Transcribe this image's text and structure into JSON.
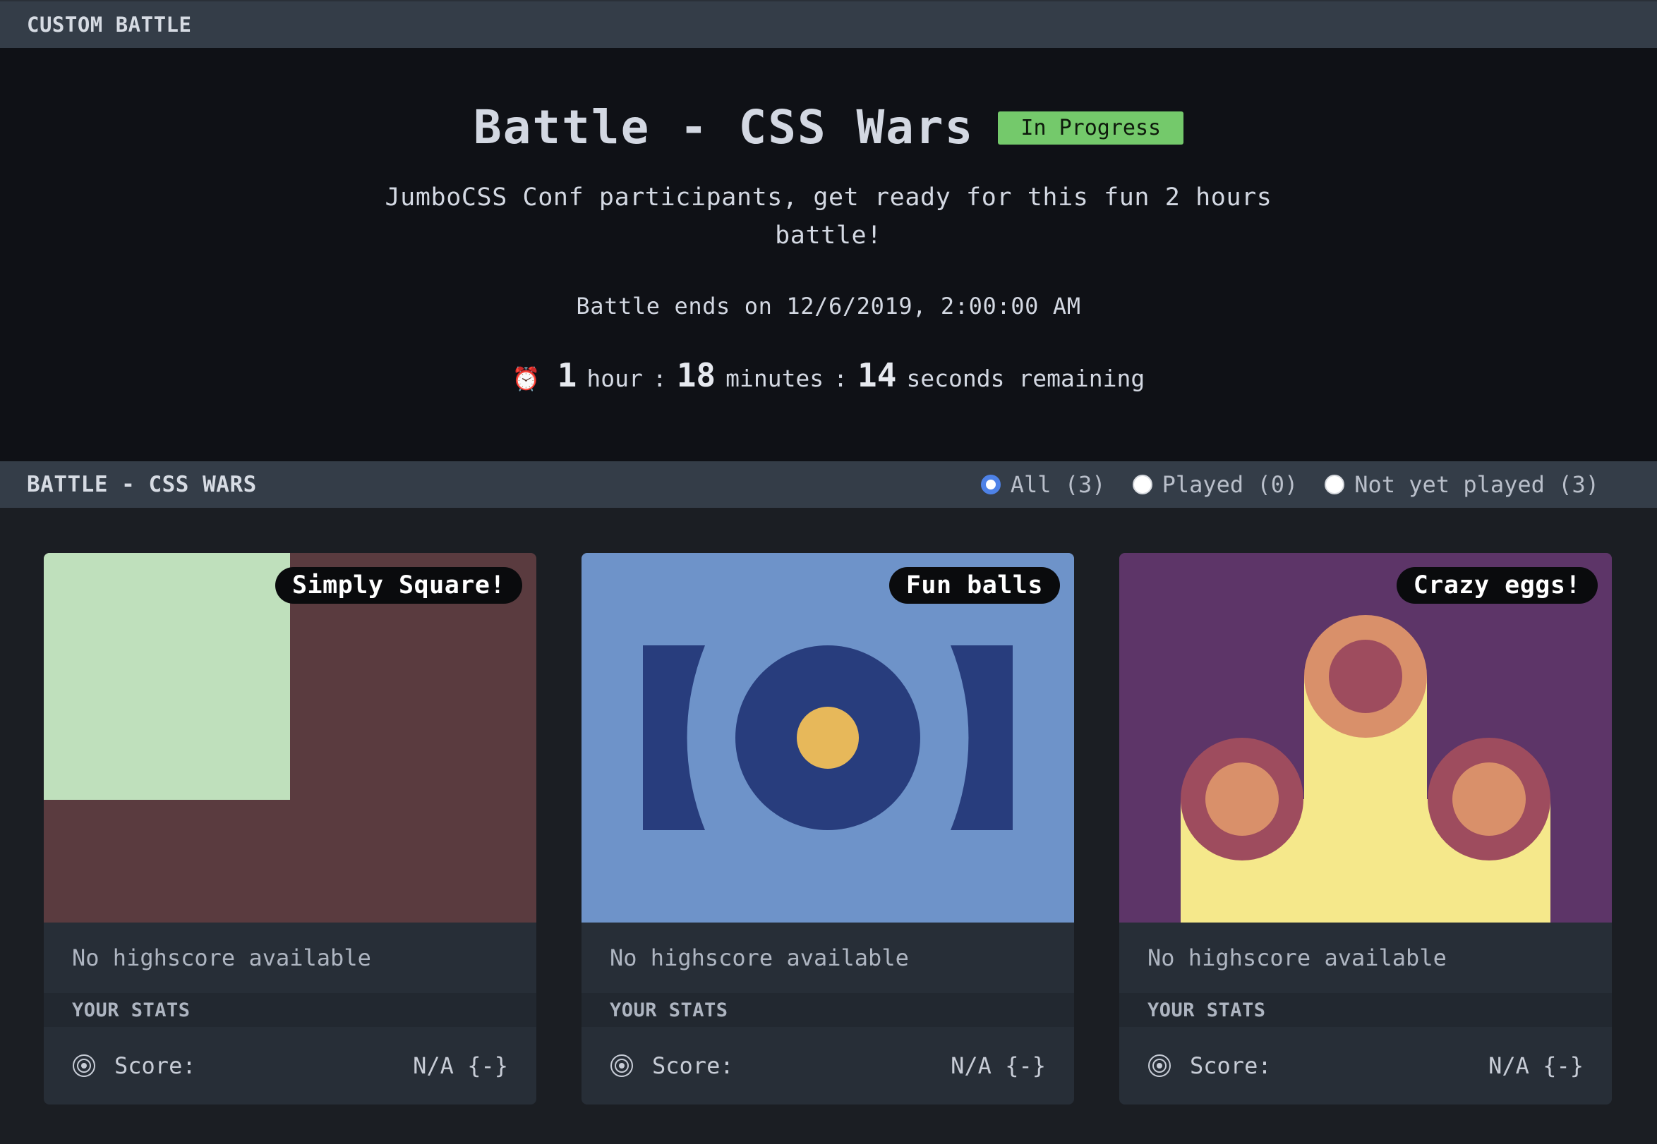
{
  "topbar": {
    "title": "CUSTOM BATTLE"
  },
  "hero": {
    "title": "Battle - CSS Wars",
    "status": "In Progress",
    "description": "JumboCSS Conf participants, get ready for this fun 2 hours battle!",
    "ends": "Battle ends on 12/6/2019, 2:00:00 AM",
    "countdown": {
      "clock_icon": "⏰",
      "hours": "1",
      "hours_label": "hour",
      "sep1": ":",
      "minutes": "18",
      "minutes_label": "minutes",
      "sep2": ":",
      "seconds": "14",
      "seconds_label": "seconds remaining"
    }
  },
  "section": {
    "title": "BATTLE - CSS WARS",
    "filters": [
      {
        "label": "All (3)",
        "checked": true
      },
      {
        "label": "Played (0)",
        "checked": false
      },
      {
        "label": "Not yet played (3)",
        "checked": false
      }
    ]
  },
  "cards": [
    {
      "name": "Simply Square!",
      "highscore": "No highscore available",
      "stats_title": "YOUR STATS",
      "score_label": "Score:",
      "score_value": "N/A {-}",
      "colors": {
        "bg": "#5a3b3f",
        "square": "#bfe0bc"
      }
    },
    {
      "name": "Fun balls",
      "highscore": "No highscore available",
      "stats_title": "YOUR STATS",
      "score_label": "Score:",
      "score_value": "N/A {-}",
      "colors": {
        "bg": "#6e93c9",
        "dark": "#283d7d",
        "dot": "#e7b85a"
      }
    },
    {
      "name": "Crazy eggs!",
      "highscore": "No highscore available",
      "stats_title": "YOUR STATS",
      "score_label": "Score:",
      "score_value": "N/A {-}",
      "colors": {
        "bg": "#5d3568",
        "yellow": "#f5e88b",
        "ring": "#9e4c5e",
        "inner": "#d9906a"
      }
    }
  ],
  "icons": {
    "clock": "alarm-clock-icon",
    "target": "target-icon"
  }
}
